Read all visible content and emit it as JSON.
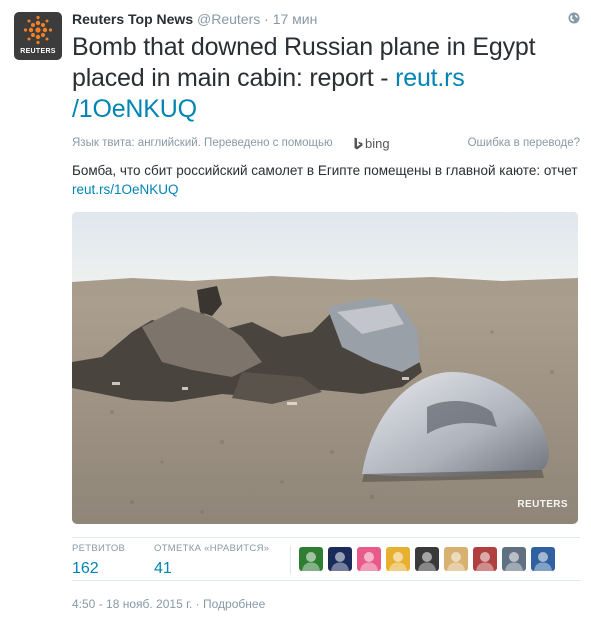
{
  "tweet": {
    "fullname": "Reuters Top News",
    "username": "@Reuters",
    "separator": "·",
    "time": "17 мин",
    "text_before_link": "Bomb that downed Russian plane in Egypt placed in main cabin: report - ",
    "link": "reut.rs /1OeNKUQ",
    "avatar_word": "REUTERS"
  },
  "translation": {
    "label": "Язык твита: английский. Переведено с помощью",
    "provider": "bing",
    "error_link": "Ошибка в переводе?",
    "text_before_link": "Бомба, что сбит российский самолет в Египте помещены в главной каюте: отчет ",
    "link": "reut.rs/1OeNKUQ"
  },
  "media": {
    "credit": "REUTERS"
  },
  "stats": {
    "retweets_label": "РЕТВИТОВ",
    "retweets": "162",
    "likes_label": "ОТМЕТКА «НРАВИТСЯ»",
    "likes": "41"
  },
  "favorited_by": [
    {
      "icon": "avatar-green-logo",
      "color": "#2e7d32"
    },
    {
      "icon": "avatar-seal",
      "color": "#1a2a5a"
    },
    {
      "icon": "avatar-colorful",
      "color": "#e85a8a"
    },
    {
      "icon": "avatar-yellow",
      "color": "#e8b030"
    },
    {
      "icon": "avatar-person-dark",
      "color": "#3a3a3a"
    },
    {
      "icon": "avatar-person-blonde",
      "color": "#d8b070"
    },
    {
      "icon": "avatar-car",
      "color": "#b04040"
    },
    {
      "icon": "avatar-person-glasses",
      "color": "#607080"
    },
    {
      "icon": "avatar-person-blue",
      "color": "#3060a0"
    }
  ],
  "footer": {
    "timestamp": "4:50 - 18 нояб. 2015 г.",
    "separator": "·",
    "details_link": "Подробнее"
  },
  "colors": {
    "link": "#0084b4",
    "muted": "#8899a6",
    "text": "#292f33",
    "border": "#e1e8ed"
  }
}
